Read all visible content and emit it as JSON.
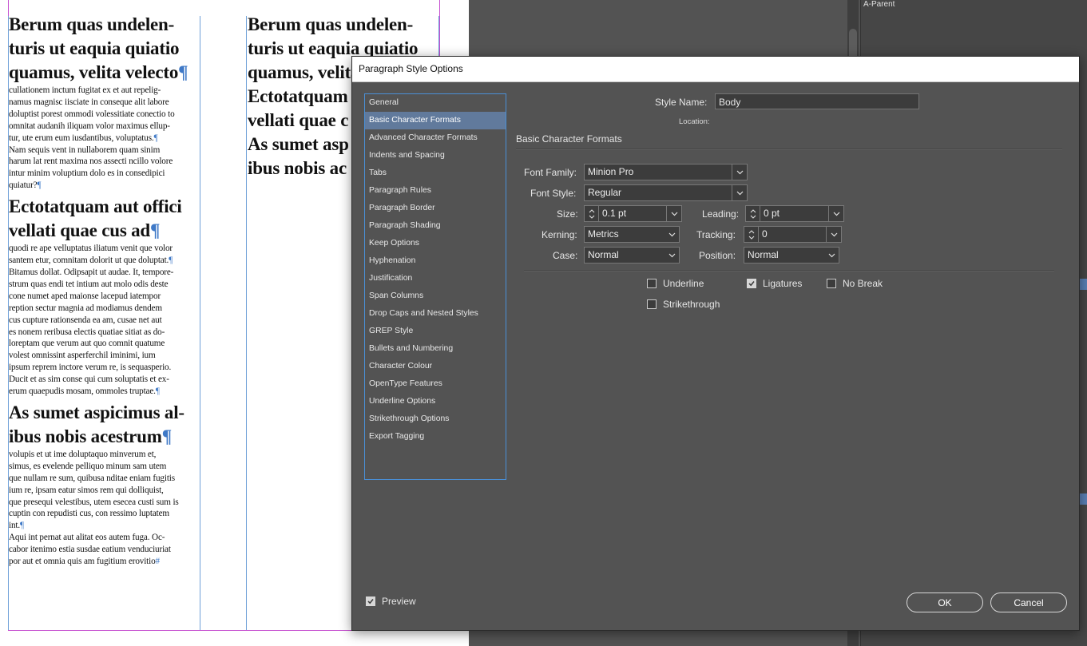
{
  "document": {
    "column1": [
      {
        "type": "heading",
        "text": "Berum quas undelen-"
      },
      {
        "type": "heading",
        "text": "turis ut eaquia quiatio"
      },
      {
        "type": "heading",
        "text": "quamus, velita velecto",
        "pil": "¶"
      },
      {
        "type": "body",
        "text": "cullationem inctum fugitat ex et aut repelig-"
      },
      {
        "type": "body",
        "text": "namus magnisc iisciate in conseque alit labore"
      },
      {
        "type": "body",
        "text": "doluptist porest ommodi volessitiate conectio to"
      },
      {
        "type": "body",
        "text": "omnitat audanih iliquam volor maximus ellup-"
      },
      {
        "type": "body",
        "text": "tur, ute erum eum iusdantibus, voluptatus.",
        "pil": "¶"
      },
      {
        "type": "body",
        "text": "Nam sequis vent in nullaborem quam sinim"
      },
      {
        "type": "body",
        "text": "harum lat rent maxima nos assecti ncillo volore"
      },
      {
        "type": "body",
        "text": "intur minim voluptium dolo es in consedipici"
      },
      {
        "type": "body",
        "text": "quiatur?",
        "pil": "¶"
      },
      {
        "type": "gap"
      },
      {
        "type": "heading",
        "text": "Ectotatquam aut offici"
      },
      {
        "type": "heading",
        "text": "vellati quae cus ad",
        "pil": "¶"
      },
      {
        "type": "body",
        "text": "quodi re ape velluptatus iliatum venit que volor"
      },
      {
        "type": "body",
        "text": "santem etur, comnitam dolorit ut que doluptat.",
        "pil": "¶"
      },
      {
        "type": "body",
        "text": "Bitamus dollat. Odipsapit ut audae. It, tempore-"
      },
      {
        "type": "body",
        "text": "strum quas endi tet intium aut molo odis deste"
      },
      {
        "type": "body",
        "text": "cone numet aped maionse lacepud iatempor"
      },
      {
        "type": "body",
        "text": "reption sectur magnia ad modiamus dendem"
      },
      {
        "type": "body",
        "text": "cus cupture rationsenda ea am, cusae net aut"
      },
      {
        "type": "body",
        "text": "es nonem reribusa electis quatiae sitiat as do-"
      },
      {
        "type": "body",
        "text": "loreptam que verum aut quo comnit quatume"
      },
      {
        "type": "body",
        "text": "volest omnissint asperferchil iminimi, ium"
      },
      {
        "type": "body",
        "text": "ipsum reprem inctore verum re, is sequasperio."
      },
      {
        "type": "body",
        "text": "Ducit et as sim conse qui cum soluptatis et ex-"
      },
      {
        "type": "body",
        "text": "erum quaepudis mosam, ommoles truptae.",
        "pil": "¶"
      },
      {
        "type": "gap"
      },
      {
        "type": "heading",
        "text": "As sumet aspicimus al-"
      },
      {
        "type": "heading",
        "text": "ibus nobis acestrum",
        "pil": "¶"
      },
      {
        "type": "body",
        "text": "volupis et ut ime doluptaquo minverum et,"
      },
      {
        "type": "body",
        "text": "simus, es evelende pelliquo minum sam utem"
      },
      {
        "type": "body",
        "text": "que nullam re sum, quibusa nditae eniam fugitis"
      },
      {
        "type": "body",
        "text": "ium re, ipsam eatur simos rem qui dolliquist,"
      },
      {
        "type": "body",
        "text": "que presequi velestibus, utem esecea custi sum is"
      },
      {
        "type": "body",
        "text": "cuptin con repudisti cus, con ressimo luptatem"
      },
      {
        "type": "body",
        "text": "int.",
        "pil": "¶"
      },
      {
        "type": "body",
        "text": "Aqui int pernat aut alitat eos autem fuga. Oc-"
      },
      {
        "type": "body",
        "text": "cabor itenimo estia susdae eatium venduciuriat"
      },
      {
        "type": "body",
        "text": "por aut et omnia quis am fugitium erovitio",
        "pil": "#"
      }
    ],
    "column2": [
      {
        "type": "heading",
        "text": "Berum quas undelen-"
      },
      {
        "type": "heading",
        "text": "turis ut eaquia quiatio"
      },
      {
        "type": "heading",
        "text": "quamus, velita"
      },
      {
        "type": "heading",
        "text": "Ectotatquam"
      },
      {
        "type": "heading",
        "text": "vellati quae c"
      },
      {
        "type": "heading",
        "text": "As sumet asp"
      },
      {
        "type": "heading",
        "text": "ibus nobis ac"
      }
    ]
  },
  "app": {
    "panel_label": "A-Parent"
  },
  "dialog": {
    "title": "Paragraph Style Options",
    "categories": [
      {
        "label": "General"
      },
      {
        "label": "Basic Character Formats",
        "selected": true
      },
      {
        "label": "Advanced Character Formats"
      },
      {
        "label": "Indents and Spacing"
      },
      {
        "label": "Tabs"
      },
      {
        "label": "Paragraph Rules"
      },
      {
        "label": "Paragraph Border"
      },
      {
        "label": "Paragraph Shading"
      },
      {
        "label": "Keep Options"
      },
      {
        "label": "Hyphenation"
      },
      {
        "label": "Justification"
      },
      {
        "label": "Span Columns"
      },
      {
        "label": "Drop Caps and Nested Styles"
      },
      {
        "label": "GREP Style"
      },
      {
        "label": "Bullets and Numbering"
      },
      {
        "label": "Character Colour"
      },
      {
        "label": "OpenType Features"
      },
      {
        "label": "Underline Options"
      },
      {
        "label": "Strikethrough Options"
      },
      {
        "label": "Export Tagging"
      }
    ],
    "style_name_label": "Style Name:",
    "style_name_value": "Body",
    "location_label": "Location:",
    "section_title": "Basic Character Formats",
    "font_family": {
      "label": "Font Family:",
      "value": "Minion Pro"
    },
    "font_style": {
      "label": "Font Style:",
      "value": "Regular"
    },
    "size": {
      "label": "Size:",
      "value": "0.1 pt"
    },
    "leading": {
      "label": "Leading:",
      "value": "0 pt"
    },
    "kerning": {
      "label": "Kerning:",
      "value": "Metrics"
    },
    "tracking": {
      "label": "Tracking:",
      "value": "0"
    },
    "case": {
      "label": "Case:",
      "value": "Normal"
    },
    "position": {
      "label": "Position:",
      "value": "Normal"
    },
    "checkboxes": {
      "underline": {
        "label": "Underline",
        "checked": false
      },
      "ligatures": {
        "label": "Ligatures",
        "checked": true
      },
      "no_break": {
        "label": "No Break",
        "checked": false
      },
      "strikethrough": {
        "label": "Strikethrough",
        "checked": false
      }
    },
    "preview": {
      "label": "Preview",
      "checked": true
    },
    "ok_label": "OK",
    "cancel_label": "Cancel"
  }
}
